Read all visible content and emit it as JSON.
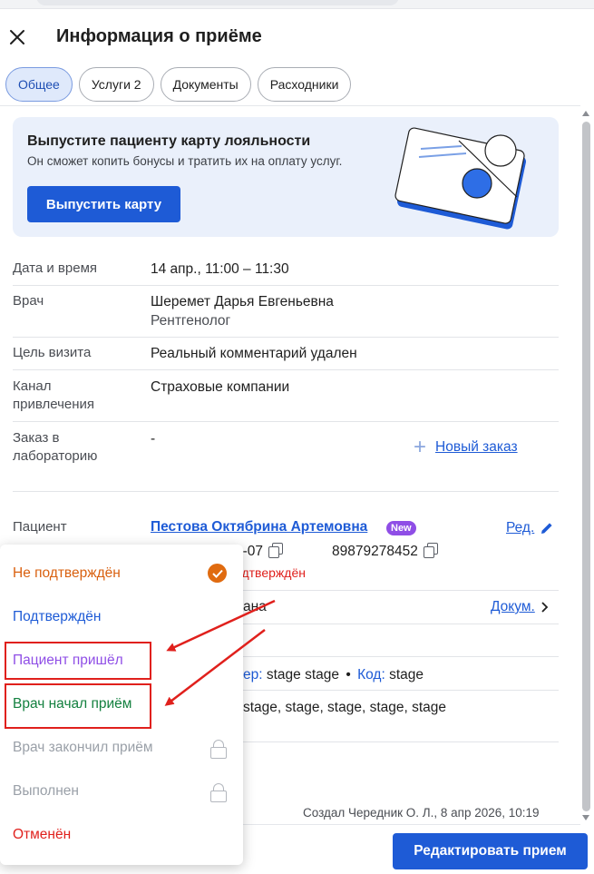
{
  "header": {
    "title": "Информация о приёме"
  },
  "tabs": [
    {
      "label": "Общее",
      "active": true
    },
    {
      "label": "Услуги 2",
      "active": false
    },
    {
      "label": "Документы",
      "active": false
    },
    {
      "label": "Расходники",
      "active": false
    }
  ],
  "promo": {
    "title": "Выпустите пациенту карту лояльности",
    "subtitle": "Он сможет копить бонусы и тратить их на оплату услуг.",
    "button": "Выпустить карту"
  },
  "details": {
    "datetime": {
      "label": "Дата и время",
      "value": "14 апр., 11:00 – 11:30"
    },
    "doctor": {
      "label": "Врач",
      "name": "Шеремет Дарья Евгеньевна",
      "role": "Рентгенолог"
    },
    "purpose": {
      "label": "Цель визита",
      "value": "Реальный комментарий удален"
    },
    "channel": {
      "label_line1": "Канал",
      "label_line2": "привлечения",
      "value": "Страховые компании"
    },
    "lab": {
      "label_line1": "Заказ в",
      "label_line2": "лабораторию",
      "value": "-",
      "new_order": "Новый заказ"
    }
  },
  "patient": {
    "label": "Пациент",
    "name": "Пестова Октябрина Артемовна",
    "badge": "New",
    "edit": "Ред.",
    "birth_fragment": "3-07",
    "phone": "89879278452",
    "status_fragment": "одтверждён",
    "doc_fragment": "ана",
    "doc_link": "Докум.",
    "policy_fragment_label": "ер:",
    "policy_value": "stage stage",
    "code_label": "Код:",
    "code_value": "stage",
    "tags_fragment": "stage, stage, stage, stage, stage"
  },
  "footer": {
    "created": "Создал Чередник О. Л., 8 апр 2026, 10:19",
    "edit_button": "Редактировать прием"
  },
  "status_menu": {
    "items": [
      {
        "label": "Не подтверждён",
        "color": "#d9600f",
        "state": "checked"
      },
      {
        "label": "Подтверждён",
        "color": "#1e5bd6",
        "state": "normal"
      },
      {
        "label": "Пациент пришёл",
        "color": "#8f4ee6",
        "state": "highlighted"
      },
      {
        "label": "Врач начал приём",
        "color": "#13803f",
        "state": "highlighted"
      },
      {
        "label": "Врач закончил приём",
        "color": "#9aa0a8",
        "state": "locked"
      },
      {
        "label": "Выполнен",
        "color": "#9aa0a8",
        "state": "locked"
      },
      {
        "label": "Отменён",
        "color": "#e0201c",
        "state": "normal"
      }
    ]
  },
  "colors": {
    "primary": "#1e5bd6",
    "annotation_red": "#e0201c"
  }
}
